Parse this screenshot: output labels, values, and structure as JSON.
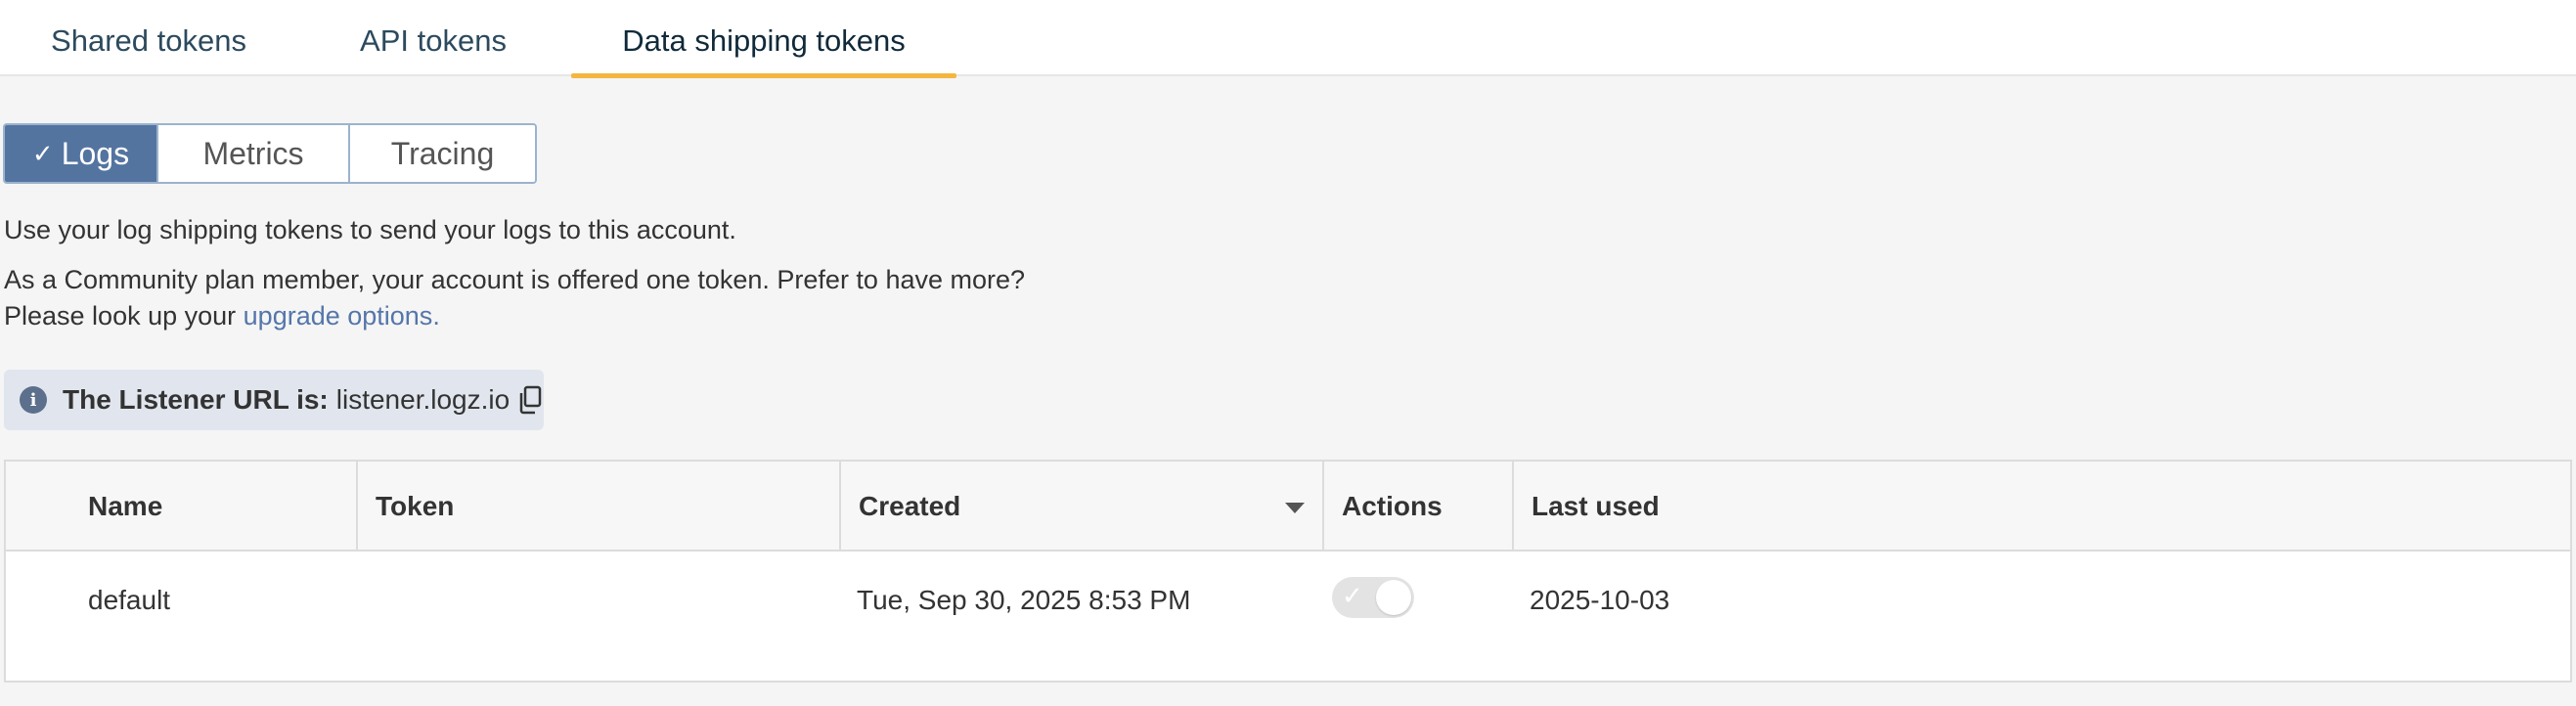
{
  "tabs": [
    {
      "label": "Shared tokens"
    },
    {
      "label": "API tokens"
    },
    {
      "label": "Data shipping tokens",
      "active": true
    }
  ],
  "segments": [
    {
      "label": "Logs",
      "active": true
    },
    {
      "label": "Metrics"
    },
    {
      "label": "Tracing"
    }
  ],
  "description": "Use your log shipping tokens to send your logs to this account.",
  "community_line1": "As a Community plan member, your account is offered one token. Prefer to have more?",
  "community_line2_prefix": "Please look up your ",
  "upgrade_link": "upgrade options",
  "community_line2_suffix": ".",
  "listener": {
    "label": "The Listener URL is:",
    "url": "listener.logz.io"
  },
  "table": {
    "headers": {
      "name": "Name",
      "token": "Token",
      "created": "Created",
      "actions": "Actions",
      "last_used": "Last used"
    },
    "rows": [
      {
        "name": "default",
        "token": "",
        "created": "Tue, Sep 30, 2025 8:53 PM",
        "enabled": true,
        "last_used": "2025-10-03"
      }
    ]
  },
  "colors": {
    "accent": "#f4b63f",
    "segment_active": "#5474a0",
    "link": "#5476aa"
  },
  "icons": {
    "check": "check-icon",
    "info": "info-icon",
    "copy": "copy-icon",
    "sort": "sort-down-icon"
  }
}
